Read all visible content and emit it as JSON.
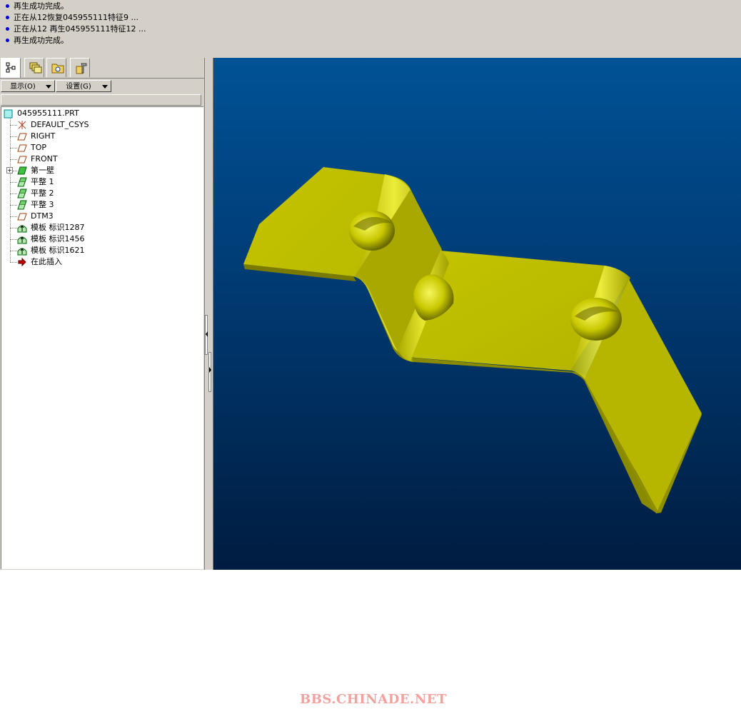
{
  "messages": [
    "再生成功完成。",
    "正在从12恢复045955111特征9 ...",
    "正在从12 再生045955111特征12 ...",
    "再生成功完成。"
  ],
  "tabs": [
    {
      "icon": "model-tree-icon"
    },
    {
      "icon": "layers-icon"
    },
    {
      "icon": "folder-browser-icon"
    },
    {
      "icon": "favorites-icon"
    }
  ],
  "toolbar": {
    "show_label": "显示(O)",
    "settings_label": "设置(G)"
  },
  "tree": {
    "root": "045955111.PRT",
    "items": [
      {
        "label": "DEFAULT_CSYS",
        "icon": "csys-icon"
      },
      {
        "label": "RIGHT",
        "icon": "datum-plane-icon"
      },
      {
        "label": "TOP",
        "icon": "datum-plane-icon"
      },
      {
        "label": "FRONT",
        "icon": "datum-plane-icon"
      },
      {
        "label": "第一壁",
        "icon": "first-wall-icon"
      },
      {
        "label": "平整 1",
        "icon": "flat-wall-icon"
      },
      {
        "label": "平整 2",
        "icon": "flat-wall-icon"
      },
      {
        "label": "平整 3",
        "icon": "flat-wall-icon"
      },
      {
        "label": "DTM3",
        "icon": "datum-plane-icon"
      },
      {
        "label": "模板 标识1287",
        "icon": "form-icon"
      },
      {
        "label": "模板 标识1456",
        "icon": "form-icon"
      },
      {
        "label": "模板 标识1621",
        "icon": "form-icon"
      },
      {
        "label": "在此插入",
        "icon": "insert-here-arrow-icon"
      }
    ]
  },
  "colors": {
    "part_yellow": "#c8c800",
    "viewport_top": "#005296",
    "viewport_bottom": "#001c40"
  },
  "watermark": "BBS.CHINADE.NET"
}
